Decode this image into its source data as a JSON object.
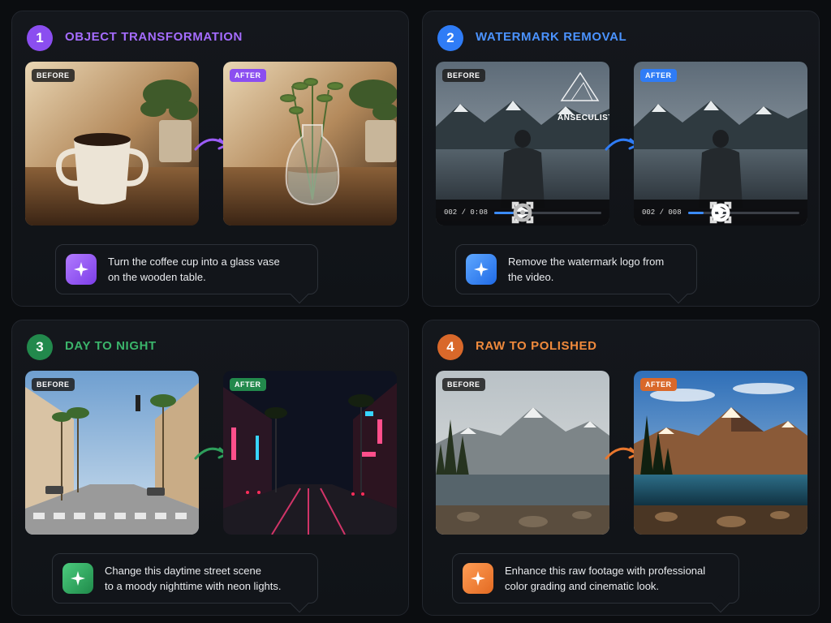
{
  "panels": [
    {
      "number": "1",
      "title": "OBJECT TRANSFORMATION",
      "accent": "#9b5cf6",
      "before_tag": "BEFORE",
      "after_tag": "AFTER",
      "prompt_line1": "Turn the coffee cup into a glass vase",
      "prompt_line2": "on the wooden table."
    },
    {
      "number": "2",
      "title": "WATERMARK REMOVAL",
      "accent": "#2f7cf6",
      "before_tag": "BEFORE",
      "after_tag": "AFTER",
      "watermark_text": "ANSECULIST",
      "before_time": "002 / 0:08",
      "after_time": "002 / 008",
      "prompt_line1": "Remove the watermark logo from",
      "prompt_line2": "the video."
    },
    {
      "number": "3",
      "title": "DAY TO NIGHT",
      "accent": "#2e9e5b",
      "before_tag": "BEFORE",
      "after_tag": "AFTER",
      "prompt_line1": "Change this daytime street scene",
      "prompt_line2": "to a moody nighttime with neon lights."
    },
    {
      "number": "4",
      "title": "RAW TO POLISHED",
      "accent": "#e8772e",
      "before_tag": "BEFORE",
      "after_tag": "AFTER",
      "prompt_line1": "Enhance this raw footage with professional",
      "prompt_line2": "color grading and cinematic look."
    }
  ],
  "icons": {
    "badge_icon": "sparkle-icon",
    "arrow_icon": "curved-arrow-icon",
    "play_icon": "play-icon",
    "settings_icon": "gear-icon",
    "fullscreen_icon": "fullscreen-icon"
  }
}
